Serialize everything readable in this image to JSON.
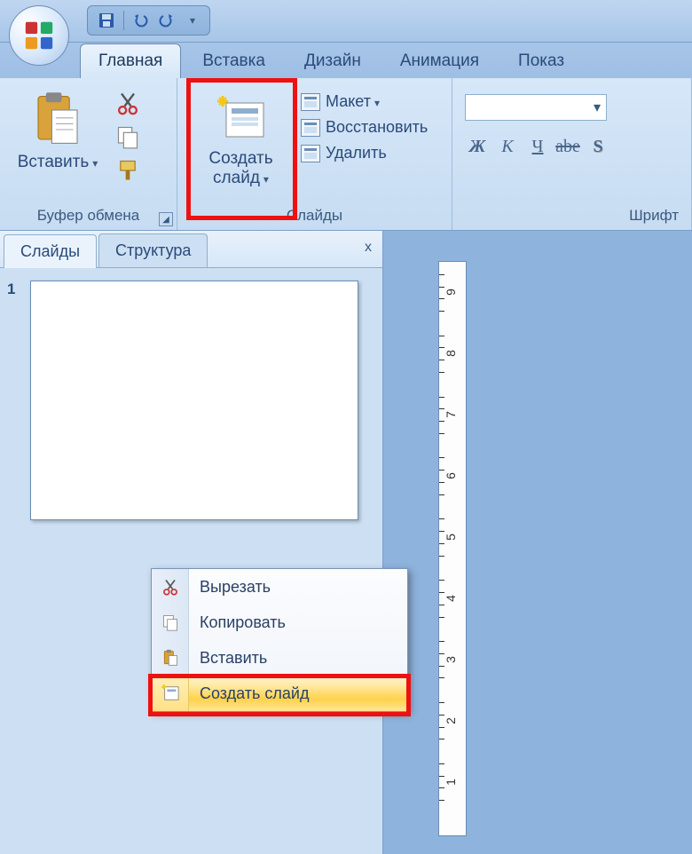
{
  "tabs": {
    "items": [
      "Главная",
      "Вставка",
      "Дизайн",
      "Анимация",
      "Показ"
    ],
    "active": 0
  },
  "ribbon": {
    "clipboard": {
      "paste": "Вставить",
      "title": "Буфер обмена"
    },
    "slides": {
      "new_line1": "Создать",
      "new_line2": "слайд",
      "layout": "Макет",
      "reset": "Восстановить",
      "delete": "Удалить",
      "title": "Слайды"
    },
    "font": {
      "title": "Шрифт",
      "bold": "Ж",
      "italic": "К",
      "underline": "Ч",
      "strike": "abe",
      "shadow": "S"
    }
  },
  "pane": {
    "tab_slides": "Слайды",
    "tab_outline": "Структура",
    "close": "x",
    "thumb_number": "1"
  },
  "context_menu": {
    "cut": "Вырезать",
    "copy": "Копировать",
    "paste": "Вставить",
    "new_slide": "Создать слайд"
  },
  "ruler": {
    "marks": [
      "1",
      "2",
      "3",
      "4",
      "5",
      "6",
      "7",
      "8",
      "9"
    ]
  }
}
